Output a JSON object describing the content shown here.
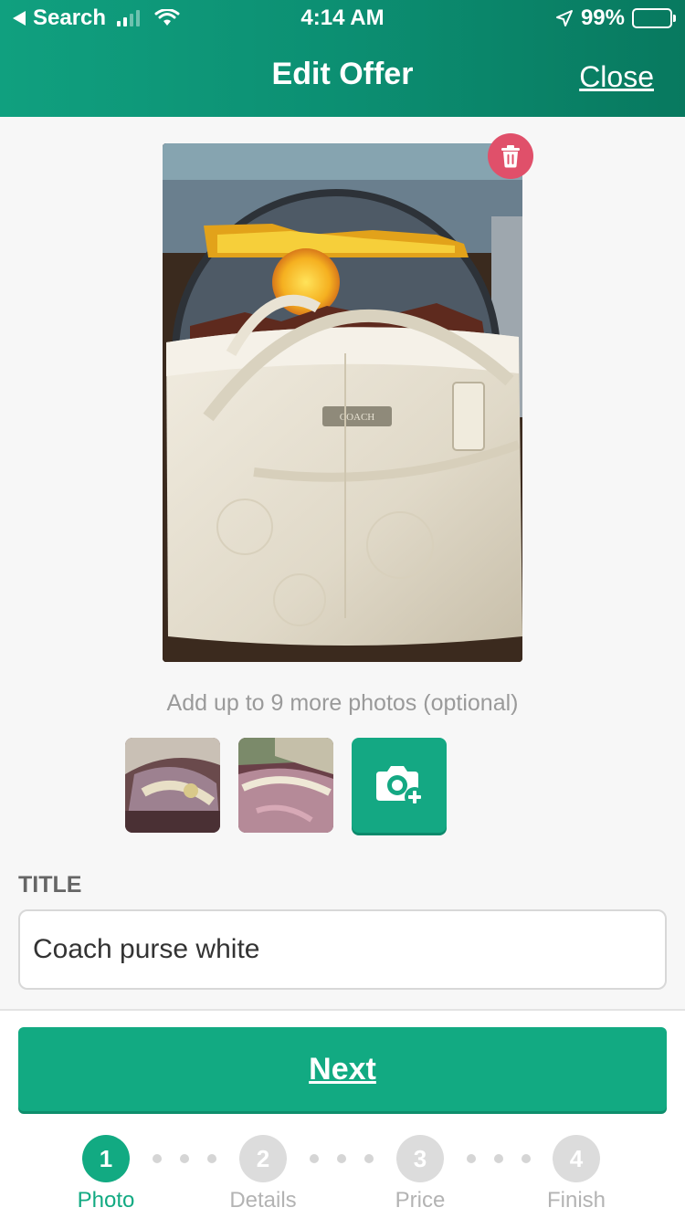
{
  "status_bar": {
    "back_label": "Search",
    "time": "4:14 AM",
    "battery": "99%"
  },
  "nav": {
    "title": "Edit Offer",
    "close_label": "Close"
  },
  "photos": {
    "hint": "Add up to 9 more photos (optional)",
    "main_brand_plate": "COACH",
    "delete_icon": "trash-icon",
    "add_icon": "camera-plus-icon"
  },
  "form": {
    "title_label": "TITLE",
    "title_value": "Coach purse white"
  },
  "footer": {
    "next_label": "Next",
    "steps": [
      {
        "number": "1",
        "label": "Photo",
        "state": "active"
      },
      {
        "number": "2",
        "label": "Details",
        "state": "inactive"
      },
      {
        "number": "3",
        "label": "Price",
        "state": "inactive"
      },
      {
        "number": "4",
        "label": "Finish",
        "state": "inactive"
      }
    ]
  },
  "colors": {
    "accent": "#12aa82",
    "header_gradient_start": "#10a07f",
    "header_gradient_end": "#08795f",
    "delete": "#e0506a"
  }
}
